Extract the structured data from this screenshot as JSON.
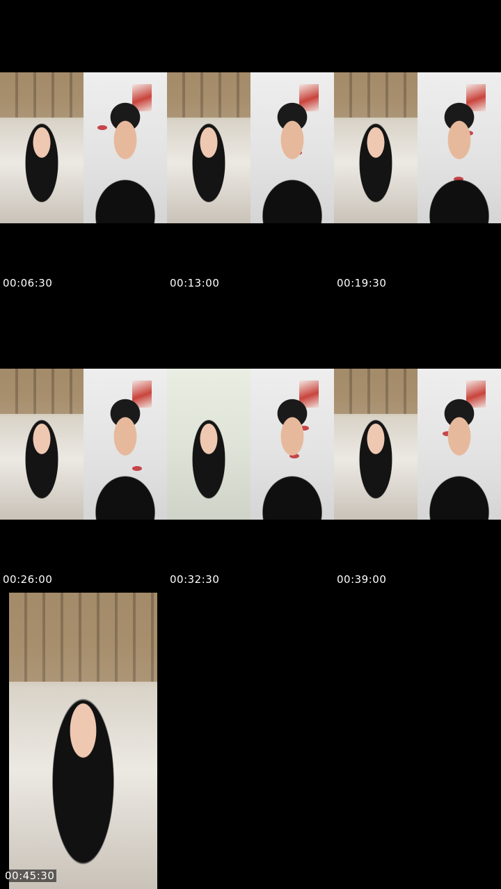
{
  "timestamps": [
    "00:06:30",
    "00:13:00",
    "00:19:30",
    "00:26:00",
    "00:32:30",
    "00:39:00",
    "00:45:30"
  ],
  "rows": [
    {
      "frames": [
        {
          "scene": "room",
          "subject": "girl"
        },
        {
          "scene": "wall",
          "subject": "boy"
        },
        {
          "scene": "room",
          "subject": "girl"
        },
        {
          "scene": "wall",
          "subject": "boy"
        },
        {
          "scene": "room",
          "subject": "girl"
        },
        {
          "scene": "wall",
          "subject": "boy"
        }
      ]
    },
    {
      "frames": [
        {
          "scene": "room",
          "subject": "girl"
        },
        {
          "scene": "wall",
          "subject": "boy"
        },
        {
          "scene": "room2",
          "subject": "girl"
        },
        {
          "scene": "wall",
          "subject": "boy"
        },
        {
          "scene": "room",
          "subject": "girl"
        },
        {
          "scene": "wall",
          "subject": "boy"
        }
      ]
    }
  ],
  "final_frame": {
    "scene": "room",
    "subject": "girl"
  }
}
